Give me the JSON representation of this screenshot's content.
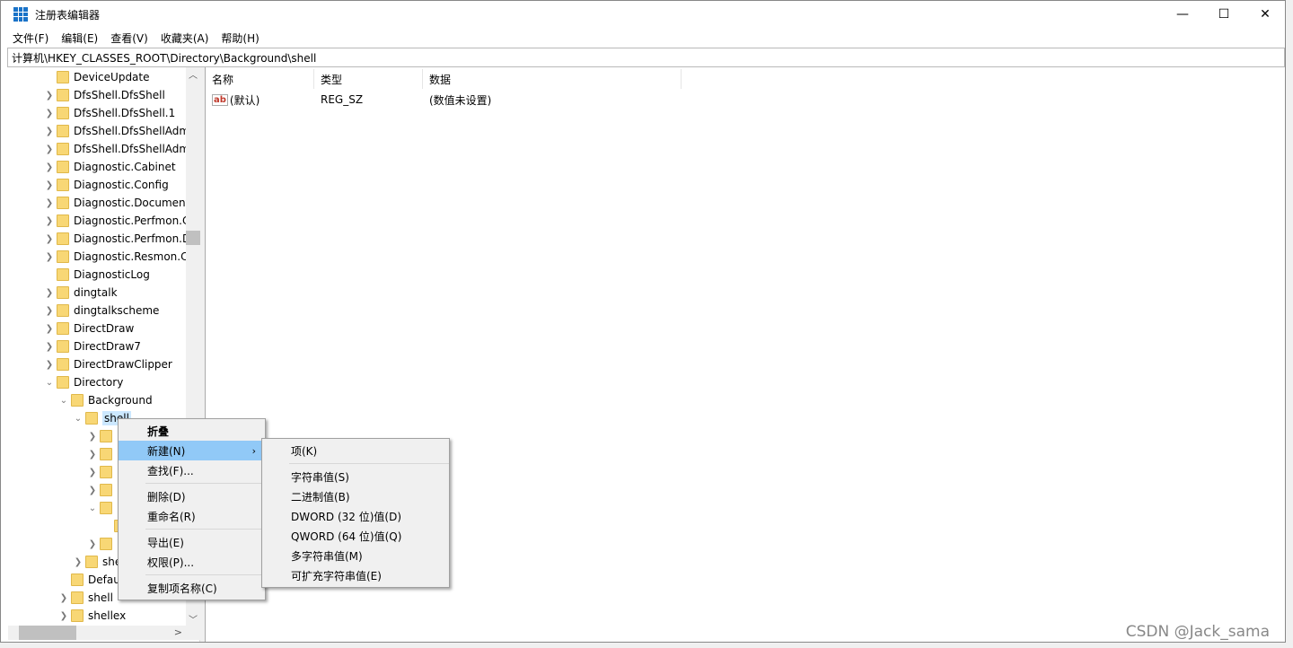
{
  "window": {
    "title": "注册表编辑器",
    "minimize": "—",
    "maximize": "☐",
    "close": "✕",
    "icon": "registry-editor-icon"
  },
  "menubar": [
    "文件(F)",
    "编辑(E)",
    "查看(V)",
    "收藏夹(A)",
    "帮助(H)"
  ],
  "address": "计算机\\HKEY_CLASSES_ROOT\\Directory\\Background\\shell",
  "tree": [
    {
      "label": "DeviceUpdate",
      "level": 0,
      "exp": ""
    },
    {
      "label": "DfsShell.DfsShell",
      "level": 0,
      "exp": ">"
    },
    {
      "label": "DfsShell.DfsShell.1",
      "level": 0,
      "exp": ">"
    },
    {
      "label": "DfsShell.DfsShellAdm",
      "level": 0,
      "exp": ">"
    },
    {
      "label": "DfsShell.DfsShellAdm",
      "level": 0,
      "exp": ">"
    },
    {
      "label": "Diagnostic.Cabinet",
      "level": 0,
      "exp": ">"
    },
    {
      "label": "Diagnostic.Config",
      "level": 0,
      "exp": ">"
    },
    {
      "label": "Diagnostic.Document",
      "level": 0,
      "exp": ">"
    },
    {
      "label": "Diagnostic.Perfmon.C",
      "level": 0,
      "exp": ">"
    },
    {
      "label": "Diagnostic.Perfmon.D",
      "level": 0,
      "exp": ">"
    },
    {
      "label": "Diagnostic.Resmon.C",
      "level": 0,
      "exp": ">"
    },
    {
      "label": "DiagnosticLog",
      "level": 0,
      "exp": ""
    },
    {
      "label": "dingtalk",
      "level": 0,
      "exp": ">"
    },
    {
      "label": "dingtalkscheme",
      "level": 0,
      "exp": ">"
    },
    {
      "label": "DirectDraw",
      "level": 0,
      "exp": ">"
    },
    {
      "label": "DirectDraw7",
      "level": 0,
      "exp": ">"
    },
    {
      "label": "DirectDrawClipper",
      "level": 0,
      "exp": ">"
    },
    {
      "label": "Directory",
      "level": 0,
      "exp": "v"
    },
    {
      "label": "Background",
      "level": 1,
      "exp": "v"
    },
    {
      "label": "shell",
      "level": 2,
      "exp": "v",
      "selected": true
    },
    {
      "label": "",
      "level": 3,
      "exp": ">"
    },
    {
      "label": "",
      "level": 3,
      "exp": ">"
    },
    {
      "label": "",
      "level": 3,
      "exp": ">"
    },
    {
      "label": "",
      "level": 3,
      "exp": ">"
    },
    {
      "label": "",
      "level": 3,
      "exp": "v"
    },
    {
      "label": "",
      "level": 4,
      "exp": ""
    },
    {
      "label": "",
      "level": 3,
      "exp": ">"
    },
    {
      "label": "she",
      "level": 2,
      "exp": ">"
    },
    {
      "label": "Defau",
      "level": 1,
      "exp": ""
    },
    {
      "label": "shell",
      "level": 1,
      "exp": ">"
    },
    {
      "label": "shellex",
      "level": 1,
      "exp": ">"
    }
  ],
  "list": {
    "headers": [
      "名称",
      "类型",
      "数据"
    ],
    "rows": [
      {
        "name": "(默认)",
        "type": "REG_SZ",
        "data": "(数值未设置)",
        "icon": "ab"
      }
    ]
  },
  "context_menu": [
    {
      "label": "折叠",
      "bold": true
    },
    {
      "label": "新建(N)",
      "highlight": true,
      "submenu": true
    },
    {
      "label": "查找(F)..."
    },
    {
      "sep": true
    },
    {
      "label": "删除(D)"
    },
    {
      "label": "重命名(R)"
    },
    {
      "sep": true
    },
    {
      "label": "导出(E)"
    },
    {
      "label": "权限(P)..."
    },
    {
      "sep": true
    },
    {
      "label": "复制项名称(C)"
    }
  ],
  "submenu": [
    {
      "label": "项(K)"
    },
    {
      "sep": true
    },
    {
      "label": "字符串值(S)"
    },
    {
      "label": "二进制值(B)"
    },
    {
      "label": "DWORD (32 位)值(D)"
    },
    {
      "label": "QWORD (64 位)值(Q)"
    },
    {
      "label": "多字符串值(M)"
    },
    {
      "label": "可扩充字符串值(E)"
    }
  ],
  "watermark": "CSDN @Jack_sama",
  "colors": {
    "highlight": "#91c9f7",
    "selection": "#cce8ff",
    "folder": "#f8d775"
  }
}
